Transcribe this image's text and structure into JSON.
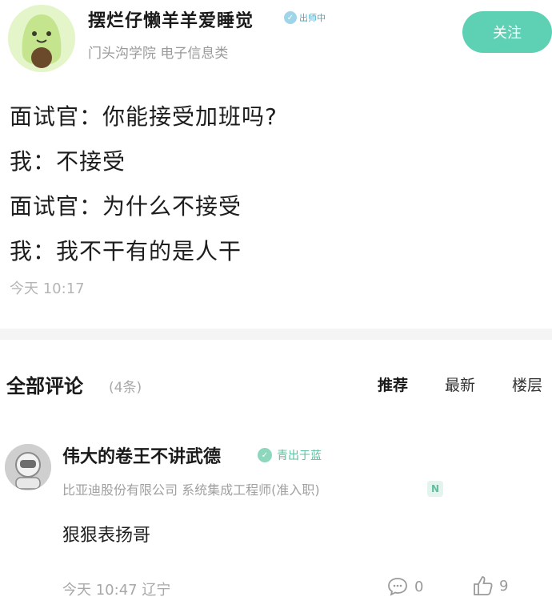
{
  "post": {
    "author_name": "摆烂仔懒羊羊爱睡觉",
    "author_badge": "出师中",
    "author_school": "门头沟学院 电子信息类",
    "follow_label": "关注",
    "lines": [
      "面试官：你能接受加班吗?",
      "我：不接受",
      "面试官：为什么不接受",
      "我：我不干有的是人干"
    ],
    "time": "今天 10:17"
  },
  "comments_section": {
    "title": "全部评论",
    "count": "(4条)",
    "tabs": [
      "推荐",
      "最新",
      "楼层"
    ]
  },
  "comment": {
    "name": "伟大的卷王不讲武德",
    "badge": "青出于蓝",
    "job": "比亚迪股份有限公司 系统集成工程师(准入职)",
    "job_tag": "N",
    "text": "狠狠表扬哥",
    "meta": "今天 10:47 辽宁",
    "reply_count": "0",
    "like_count": "9"
  },
  "icons": {
    "author_avatar": "avocado-avatar-icon",
    "commenter_avatar": "astronaut-avatar-icon",
    "reply": "comment-bubble-icon",
    "like": "thumbs-up-icon"
  },
  "colors": {
    "follow_button": "#5ed0b4",
    "badge_blue": "#4aa7c9",
    "badge_green": "#5dbf9f"
  }
}
